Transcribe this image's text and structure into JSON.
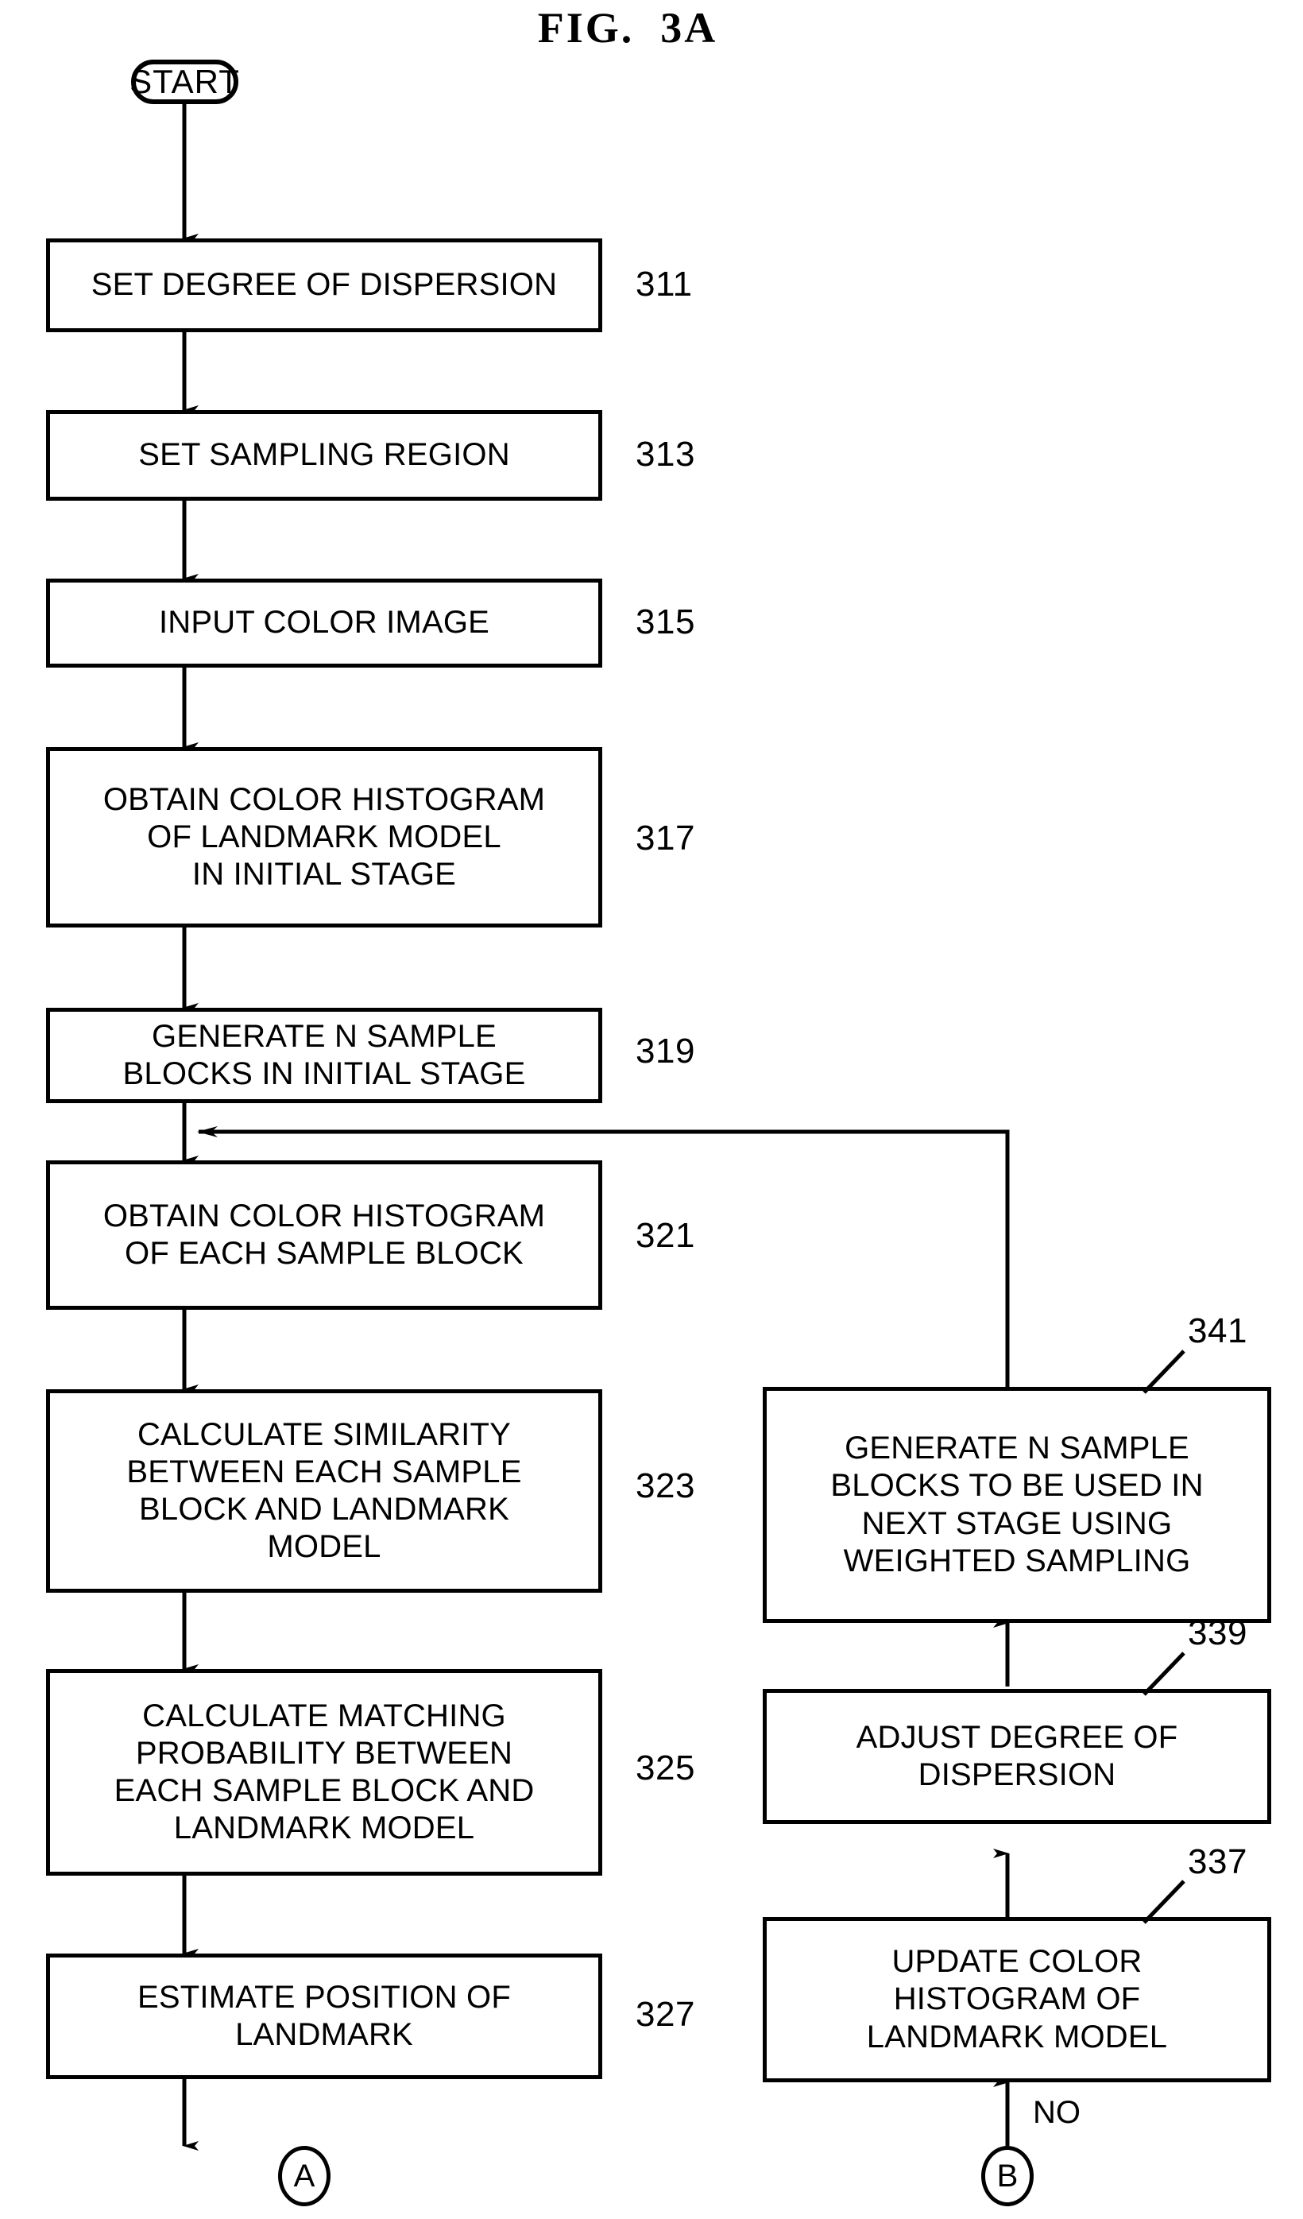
{
  "figure": {
    "title": "FIG.  3A"
  },
  "nodes": {
    "start": {
      "label": "START"
    },
    "s311": {
      "text": "SET DEGREE OF DISPERSION",
      "ref": "311"
    },
    "s313": {
      "text": "SET SAMPLING REGION",
      "ref": "313"
    },
    "s315": {
      "text": "INPUT COLOR IMAGE",
      "ref": "315"
    },
    "s317": {
      "text": "OBTAIN COLOR HISTOGRAM\nOF LANDMARK MODEL\nIN INITIAL STAGE",
      "ref": "317"
    },
    "s319": {
      "text": "GENERATE N SAMPLE\nBLOCKS IN INITIAL STAGE",
      "ref": "319"
    },
    "s321": {
      "text": "OBTAIN COLOR HISTOGRAM\nOF EACH SAMPLE BLOCK",
      "ref": "321"
    },
    "s323": {
      "text": "CALCULATE SIMILARITY\nBETWEEN EACH SAMPLE\nBLOCK AND LANDMARK\nMODEL",
      "ref": "323"
    },
    "s325": {
      "text": "CALCULATE MATCHING\nPROBABILITY BETWEEN\nEACH SAMPLE BLOCK AND\nLANDMARK MODEL",
      "ref": "325"
    },
    "s327": {
      "text": "ESTIMATE POSITION OF\nLANDMARK",
      "ref": "327"
    },
    "s341": {
      "text": "GENERATE N SAMPLE\nBLOCKS TO BE USED IN\nNEXT STAGE USING\nWEIGHTED SAMPLING",
      "ref": "341"
    },
    "s339": {
      "text": "ADJUST DEGREE OF\nDISPERSION",
      "ref": "339"
    },
    "s337": {
      "text": "UPDATE COLOR\nHISTOGRAM OF\nLANDMARK MODEL",
      "ref": "337"
    },
    "connector_a": {
      "label": "A"
    },
    "connector_b": {
      "label": "B"
    }
  },
  "edge_labels": {
    "no": "NO"
  },
  "colors": {
    "stroke": "#000000",
    "background": "#ffffff"
  }
}
